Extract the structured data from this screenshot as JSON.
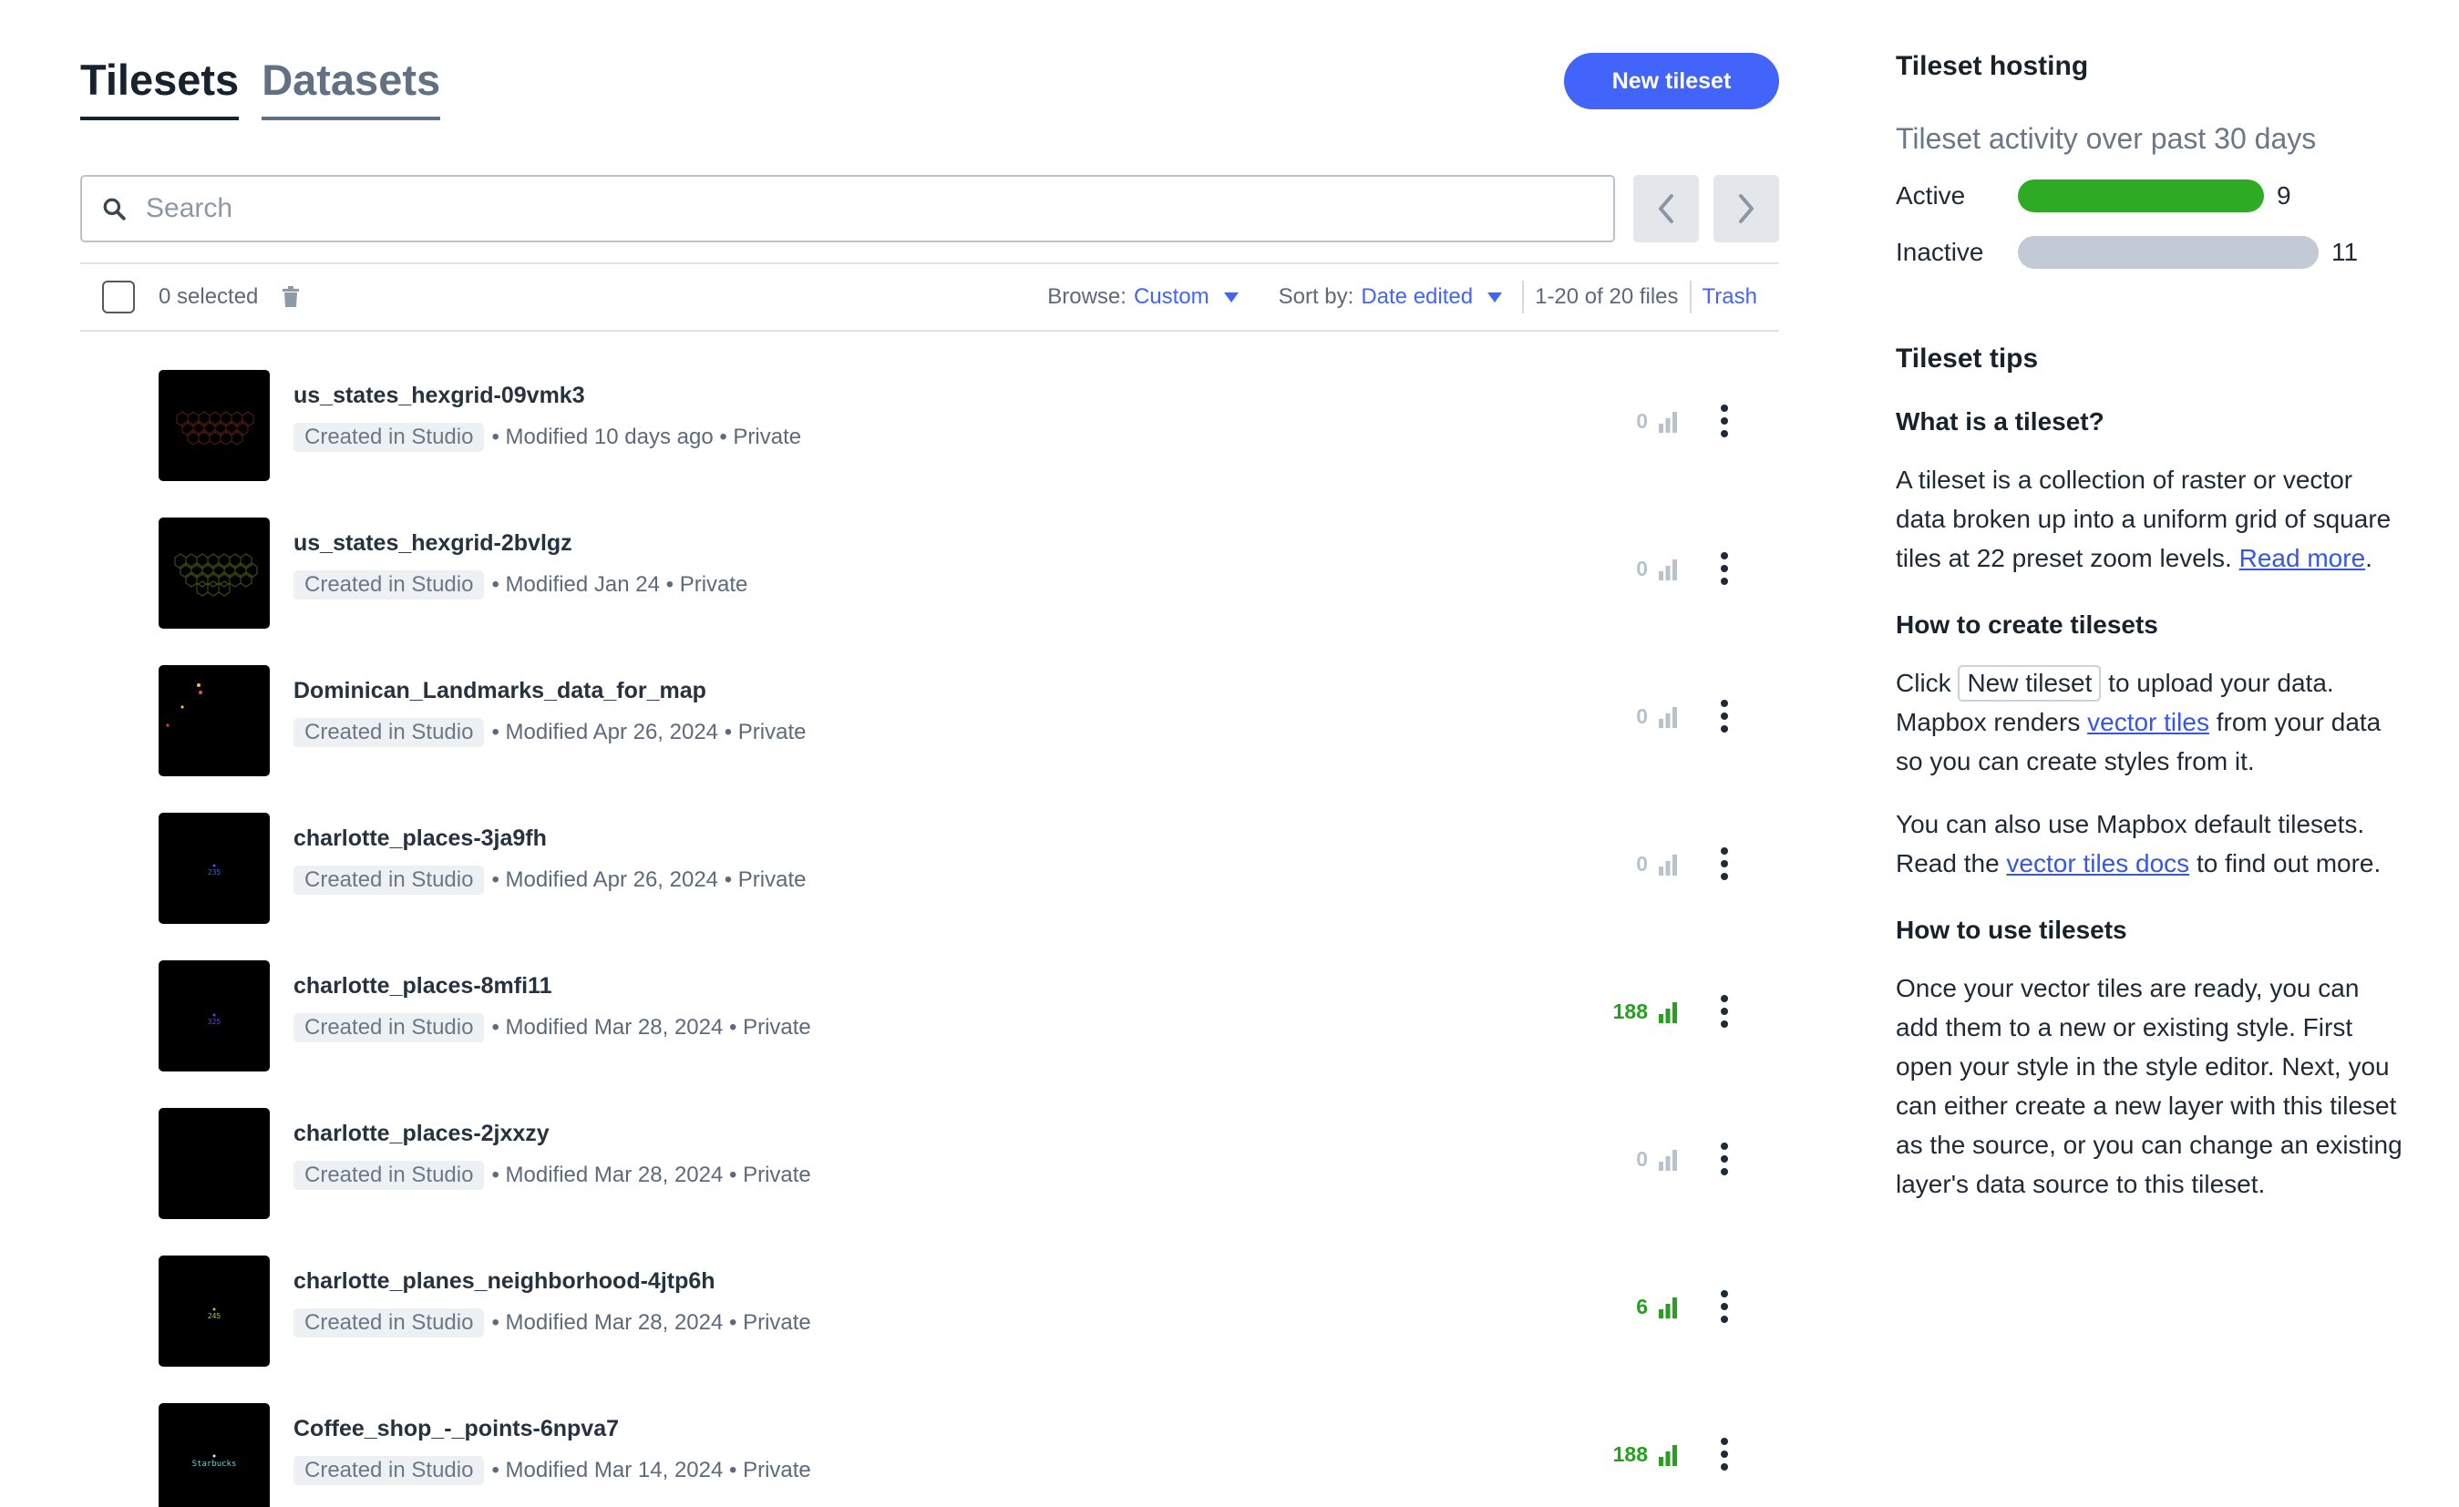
{
  "tabs": [
    {
      "label": "Tilesets",
      "active": true
    },
    {
      "label": "Datasets",
      "active": false
    }
  ],
  "new_tileset_label": "New tileset",
  "search": {
    "placeholder": "Search",
    "value": ""
  },
  "toolbar": {
    "selected": "0 selected",
    "browse_label": "Browse:",
    "browse_value": "Custom",
    "sort_label": "Sort by:",
    "sort_value": "Date edited",
    "file_count": "1-20 of 20 files",
    "trash": "Trash"
  },
  "rows": [
    {
      "name": "us_states_hexgrid-09vmk3",
      "badge": "Created in Studio",
      "meta": "• Modified 10 days ago • Private",
      "stat": "0",
      "active": false
    },
    {
      "name": "us_states_hexgrid-2bvlgz",
      "badge": "Created in Studio",
      "meta": "• Modified Jan 24 • Private",
      "stat": "0",
      "active": false
    },
    {
      "name": "Dominican_Landmarks_data_for_map",
      "badge": "Created in Studio",
      "meta": "• Modified Apr 26, 2024 • Private",
      "stat": "0",
      "active": false
    },
    {
      "name": "charlotte_places-3ja9fh",
      "badge": "Created in Studio",
      "meta": "• Modified Apr 26, 2024 • Private",
      "stat": "0",
      "active": false
    },
    {
      "name": "charlotte_places-8mfi11",
      "badge": "Created in Studio",
      "meta": "• Modified Mar 28, 2024 • Private",
      "stat": "188",
      "active": true
    },
    {
      "name": "charlotte_places-2jxxzy",
      "badge": "Created in Studio",
      "meta": "• Modified Mar 28, 2024 • Private",
      "stat": "0",
      "active": false
    },
    {
      "name": "charlotte_planes_neighborhood-4jtp6h",
      "badge": "Created in Studio",
      "meta": "• Modified Mar 28, 2024 • Private",
      "stat": "6",
      "active": true
    },
    {
      "name": "Coffee_shop_-_points-6npva7",
      "badge": "Created in Studio",
      "meta": "• Modified Mar 14, 2024 • Private",
      "stat": "188",
      "active": true
    }
  ],
  "thumb_labels": {
    "row4": "235",
    "row5": "325",
    "row7": "245",
    "row8": "Starbucks"
  },
  "sidebar": {
    "hosting_title": "Tileset hosting",
    "activity_title": "Tileset activity over past 30 days",
    "active_label": "Active",
    "active_count": "9",
    "inactive_label": "Inactive",
    "inactive_count": "11",
    "tips_title": "Tileset tips",
    "q1": "What is a tileset?",
    "p1": "A tileset is a collection of raster or vector data broken up into a uniform grid of square tiles at 22 preset zoom levels.",
    "p1_link": "Read more",
    "q2": "How to create tilesets",
    "p2_a": "Click",
    "p2_btn": "New tileset",
    "p2_b": "to upload your data. Mapbox renders",
    "p2_link": "vector tiles",
    "p2_c": "from your data so you can create styles from it.",
    "p3_a": "You can also use Mapbox default tilesets. Read the",
    "p3_link": "vector tiles docs",
    "p3_b": "to find out more.",
    "q3": "How to use tilesets",
    "p4": "Once your vector tiles are ready, you can add them to a new or existing style. First open your style in the style editor. Next, you can either create a new layer with this tileset as the source, or you can change an existing layer's data source to this tileset."
  },
  "colors": {
    "accent": "#4264fb",
    "active_green": "#2eab24",
    "inactive_gray": "#c1cad5"
  }
}
